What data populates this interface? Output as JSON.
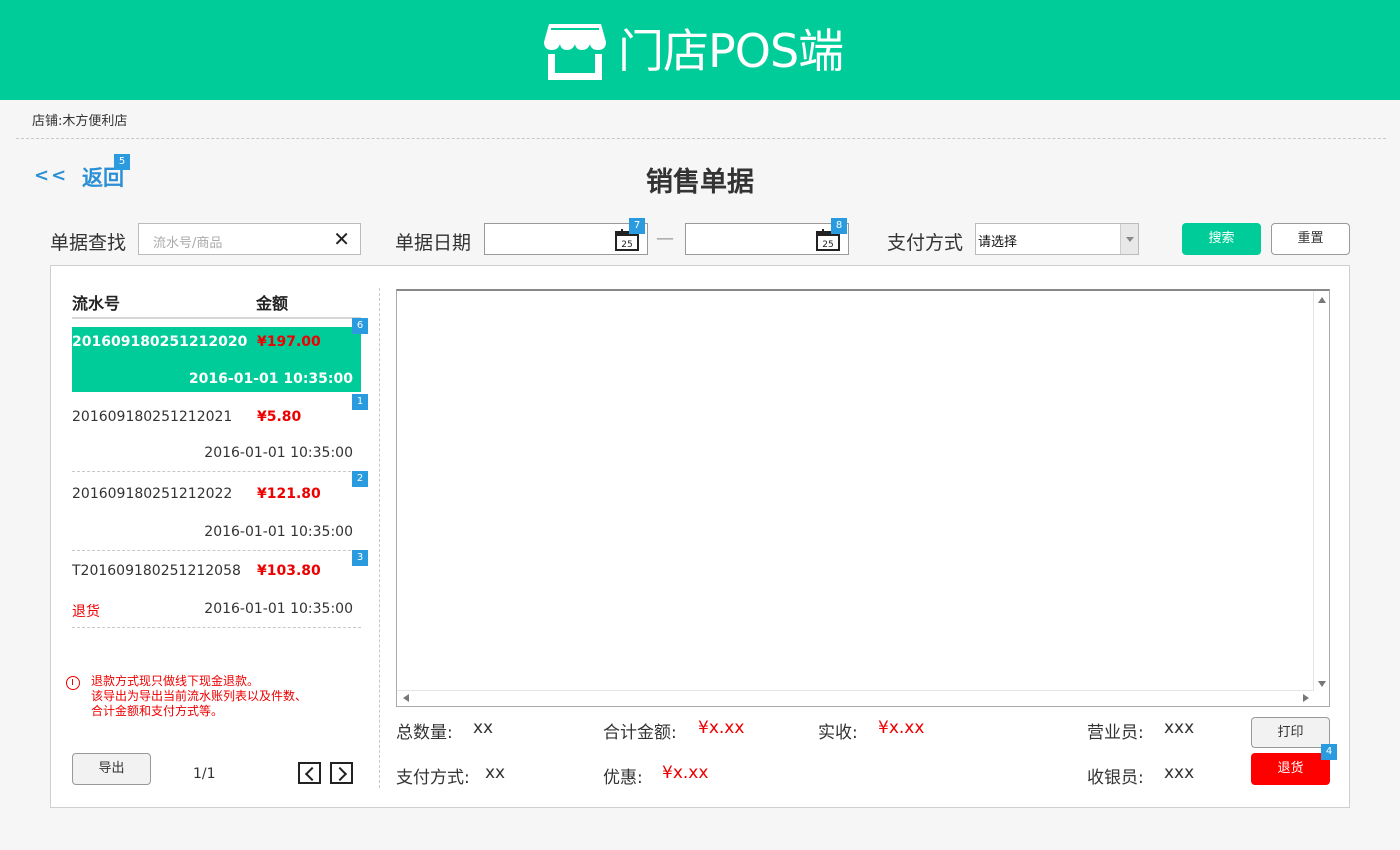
{
  "header": {
    "title": "门店POS端",
    "logo_icon": "store-icon",
    "background_color": "#00cc99"
  },
  "store": {
    "label": "店铺:",
    "name": "木方便利店"
  },
  "nav": {
    "back_arrows": "<<",
    "back_label": "返回"
  },
  "page": {
    "title": "销售单据"
  },
  "badges": {
    "back": "5",
    "date_start": "7",
    "date_end": "8",
    "row_0": "6",
    "row_1": "1",
    "row_2": "2",
    "row_3": "3",
    "return_button": "4"
  },
  "filters": {
    "search_label": "单据查找",
    "search_placeholder": "流水号/商品",
    "search_value": "",
    "clear_icon": "close-icon",
    "date_label": "单据日期",
    "date_start_value": "",
    "date_end_value": "",
    "calendar_day": "25",
    "date_separator": "—",
    "payment_label": "支付方式",
    "payment_value": "请选择",
    "search_button": "搜索",
    "reset_button": "重置"
  },
  "list": {
    "serial_header": "流水号",
    "amount_header": "金额",
    "rows": [
      {
        "serial": "201609180251212020",
        "amount": "¥197.00",
        "datetime": "2016-01-01 10:35:00",
        "status": "",
        "selected": true
      },
      {
        "serial": "201609180251212021",
        "amount": "¥5.80",
        "datetime": "2016-01-01 10:35:00",
        "status": "",
        "selected": false
      },
      {
        "serial": "201609180251212022",
        "amount": "¥121.80",
        "datetime": "2016-01-01 10:35:00",
        "status": "",
        "selected": false
      },
      {
        "serial": "T201609180251212058",
        "amount": "¥103.80",
        "datetime": "2016-01-01 10:35:00",
        "status": "退货",
        "selected": false
      }
    ],
    "notice_lines": [
      "退款方式现只做线下现金退款。",
      "该导出为导出当前流水账列表以及件数、",
      "合计金额和支付方式等。"
    ],
    "export_button": "导出",
    "page_indicator": "1/1"
  },
  "summary": {
    "total_qty_label": "总数量:",
    "total_qty_value": "xx",
    "total_amount_label": "合计金额:",
    "total_amount_value": "¥x.xx",
    "received_label": "实收:",
    "received_value": "¥x.xx",
    "salesperson_label": "营业员:",
    "salesperson_value": "xxx",
    "payment_label": "支付方式:",
    "payment_value": "xx",
    "discount_label": "优惠:",
    "discount_value": "¥x.xx",
    "cashier_label": "收银员:",
    "cashier_value": "xxx",
    "print_button": "打印",
    "return_button": "退货"
  },
  "colors": {
    "accent": "#00cc99",
    "link": "#2b8fd6",
    "badge": "#2b9be0",
    "danger": "#ff0000"
  }
}
